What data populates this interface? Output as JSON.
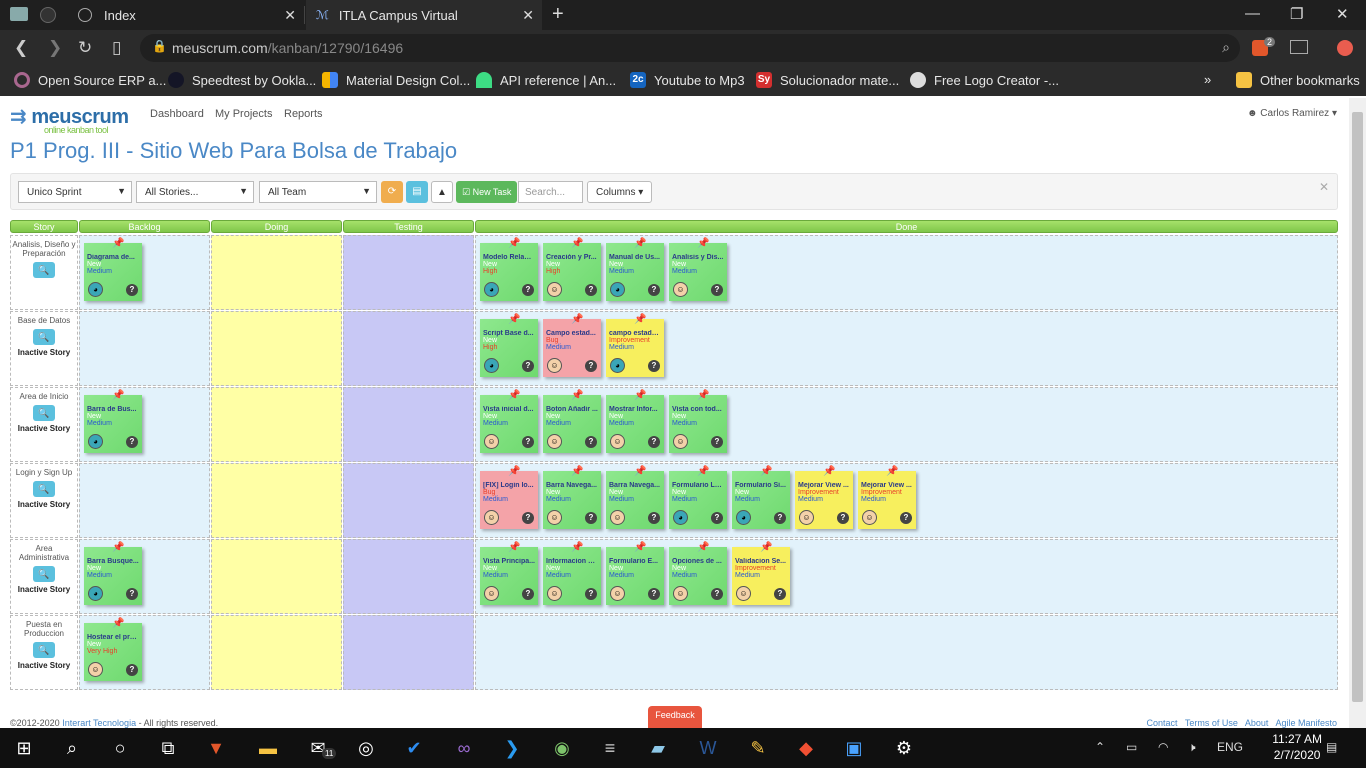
{
  "browser": {
    "tabs": [
      {
        "label": "Index"
      },
      {
        "label": "ITLA Campus Virtual"
      }
    ],
    "url_host": "meuscrum.com",
    "url_path": "/kanban/12790/16496",
    "shield_badge": "2",
    "bookmarks": [
      {
        "label": "Open Source ERP a...",
        "icon": "odoo-icon",
        "color": "#875a7b"
      },
      {
        "label": "Speedtest by Ookla...",
        "icon": "speedtest-icon",
        "color": "#141526"
      },
      {
        "label": "Material Design Col...",
        "icon": "material-icon",
        "color": "#f4b400"
      },
      {
        "label": "API reference | An...",
        "icon": "android-icon",
        "color": "#3ddc84"
      },
      {
        "label": "Youtube to Mp3",
        "icon": "2c-icon",
        "color": "#1565c0"
      },
      {
        "label": "Solucionador mate...",
        "icon": "sy-icon",
        "color": "#d32f2f"
      },
      {
        "label": "Free Logo Creator -...",
        "icon": "globe-icon",
        "color": "#555555"
      }
    ],
    "other_bookmarks": "Other bookmarks"
  },
  "app": {
    "logo_main": "meuscrum",
    "logo_tag": "online kanban tool",
    "nav": [
      "Dashboard",
      "My Projects",
      "Reports"
    ],
    "user": "Carlos Ramirez",
    "project_title": "P1 Prog. III - Sitio Web Para Bolsa de Trabajo",
    "filters": {
      "sprint": "Unico Sprint",
      "stories": "All Stories...",
      "team": "All Team",
      "new_task": "New Task",
      "search_placeholder": "Search...",
      "columns": "Columns"
    },
    "columns": [
      "Story",
      "Backlog",
      "Doing",
      "Testing",
      "Done"
    ],
    "colors": {
      "backlog_bg": "#e2f2fb",
      "doing_bg": "#ffffa5",
      "testing_bg": "#c8c8f5",
      "done_bg": "#e2f2fb"
    },
    "inactive_label": "Inactive Story",
    "stories": [
      {
        "name": "Analisis, Diseño y Preparación",
        "inactive": false,
        "backlog": [
          {
            "title": "Diagrama de...",
            "status": "New",
            "priority": "Medium",
            "color": "green",
            "pin": "blue",
            "avatar": "cat"
          }
        ],
        "done": [
          {
            "title": "Modelo Relaci...",
            "status": "New",
            "priority": "High",
            "color": "green",
            "pin": "orange",
            "avatar": "cat"
          },
          {
            "title": "Creación y Pr...",
            "status": "New",
            "priority": "High",
            "color": "green",
            "pin": "orange",
            "avatar": "man"
          },
          {
            "title": "Manual de Us...",
            "status": "New",
            "priority": "Medium",
            "color": "green",
            "pin": "blue",
            "avatar": "cat"
          },
          {
            "title": "Analisis y Dis...",
            "status": "New",
            "priority": "Medium",
            "color": "green",
            "pin": "blue",
            "avatar": "man"
          }
        ]
      },
      {
        "name": "Base de Datos",
        "inactive": true,
        "backlog": [],
        "done": [
          {
            "title": "Script Base d...",
            "status": "New",
            "priority": "High",
            "color": "green",
            "pin": "orange",
            "avatar": "cat"
          },
          {
            "title": "Campo estad...",
            "status": "Bug",
            "priority": "Medium",
            "color": "pink",
            "pin": "blue",
            "avatar": "man"
          },
          {
            "title": "campo estado...",
            "status": "Improvement",
            "priority": "Medium",
            "color": "yellow",
            "pin": "blue",
            "avatar": "cat"
          }
        ]
      },
      {
        "name": "Area de Inicio",
        "inactive": true,
        "backlog": [
          {
            "title": "Barra de Bus...",
            "status": "New",
            "priority": "Medium",
            "color": "green",
            "pin": "blue",
            "avatar": "cat"
          }
        ],
        "done": [
          {
            "title": "Vista inicial d...",
            "status": "New",
            "priority": "Medium",
            "color": "green",
            "pin": "blue",
            "avatar": "man"
          },
          {
            "title": "Boton Añadir ...",
            "status": "New",
            "priority": "Medium",
            "color": "green",
            "pin": "blue",
            "avatar": "man"
          },
          {
            "title": "Mostrar Infor...",
            "status": "New",
            "priority": "Medium",
            "color": "green",
            "pin": "blue",
            "avatar": "man"
          },
          {
            "title": "Vista con tod...",
            "status": "New",
            "priority": "Medium",
            "color": "green",
            "pin": "blue",
            "avatar": "man"
          }
        ]
      },
      {
        "name": "Login y Sign Up",
        "inactive": true,
        "backlog": [],
        "done": [
          {
            "title": "[FIX] Login lo...",
            "status": "Bug",
            "priority": "Medium",
            "color": "pink",
            "pin": "blue",
            "avatar": "man"
          },
          {
            "title": "Barra Navega...",
            "status": "New",
            "priority": "Medium",
            "color": "green",
            "pin": "blue",
            "avatar": "man"
          },
          {
            "title": "Barra Navega...",
            "status": "New",
            "priority": "Medium",
            "color": "green",
            "pin": "blue",
            "avatar": "man"
          },
          {
            "title": "Formulario Lo...",
            "status": "New",
            "priority": "Medium",
            "color": "green",
            "pin": "blue",
            "avatar": "cat"
          },
          {
            "title": "Formulario Si...",
            "status": "New",
            "priority": "Medium",
            "color": "green",
            "pin": "blue",
            "avatar": "cat"
          },
          {
            "title": "Mejorar View ...",
            "status": "Improvement",
            "priority": "Medium",
            "color": "yellow",
            "pin": "blue",
            "avatar": "man"
          },
          {
            "title": "Mejorar View ...",
            "status": "Improvement",
            "priority": "Medium",
            "color": "yellow",
            "pin": "blue",
            "avatar": "man"
          }
        ]
      },
      {
        "name": "Area Administrativa",
        "inactive": true,
        "backlog": [
          {
            "title": "Barra Busque...",
            "status": "New",
            "priority": "Medium",
            "color": "green",
            "pin": "blue",
            "avatar": "cat"
          }
        ],
        "done": [
          {
            "title": "Vista Principa...",
            "status": "New",
            "priority": "Medium",
            "color": "green",
            "pin": "blue",
            "avatar": "man"
          },
          {
            "title": "Informacion D...",
            "status": "New",
            "priority": "Medium",
            "color": "green",
            "pin": "blue",
            "avatar": "man"
          },
          {
            "title": "Formulario E...",
            "status": "New",
            "priority": "Medium",
            "color": "green",
            "pin": "blue",
            "avatar": "man"
          },
          {
            "title": "Opciones de ...",
            "status": "New",
            "priority": "Medium",
            "color": "green",
            "pin": "blue",
            "avatar": "man"
          },
          {
            "title": "Validacion Se...",
            "status": "Improvement",
            "priority": "Medium",
            "color": "yellow",
            "pin": "blue",
            "avatar": "man"
          }
        ]
      },
      {
        "name": "Puesta en Produccion",
        "inactive": true,
        "backlog": [
          {
            "title": "Hostear el pro...",
            "status": "New",
            "priority": "Very High",
            "color": "green",
            "pin": "red",
            "avatar": "man"
          }
        ],
        "done": []
      }
    ],
    "footer": {
      "copyright": "©2012-2020",
      "company": "Interart Tecnologia",
      "rights": "- All rights reserved.",
      "links": [
        "Contact",
        "Terms of Use",
        "About",
        "Agile Manifesto"
      ],
      "feedback": "Feedback"
    }
  },
  "taskbar": {
    "mail_badge": "11",
    "lang": "ENG",
    "time": "11:27 AM",
    "date": "2/7/2020"
  }
}
